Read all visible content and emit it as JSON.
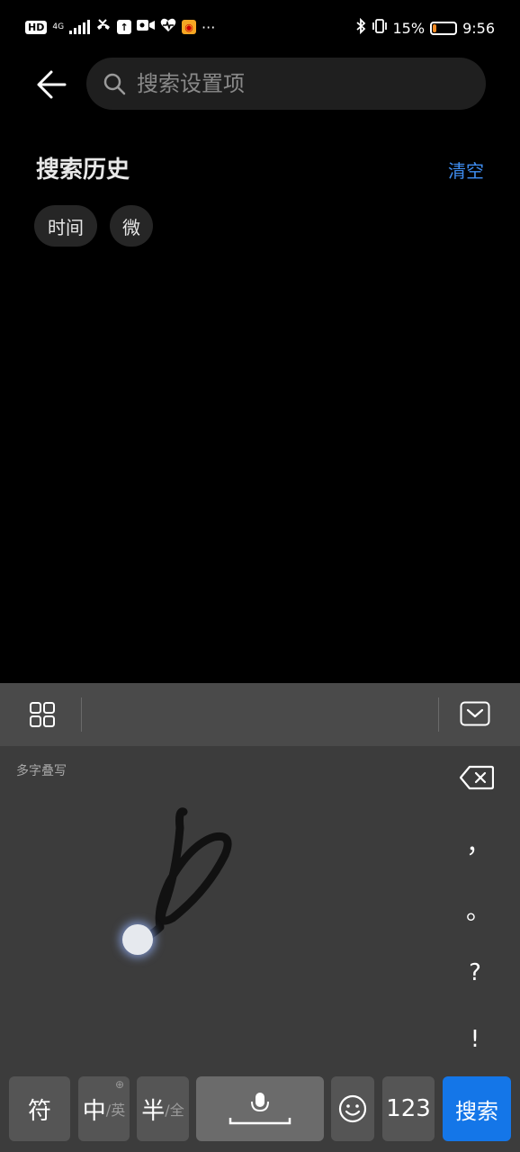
{
  "status_bar": {
    "left_hd": "HD",
    "left_network": "4G",
    "more": "···",
    "battery_percent": "15%",
    "battery_level": 0.15,
    "time": "9:56"
  },
  "header": {
    "search_placeholder": "搜索设置项"
  },
  "history": {
    "title": "搜索历史",
    "clear_label": "清空",
    "items": [
      "时间",
      "微"
    ]
  },
  "keyboard": {
    "mode_label": "多字叠写",
    "punctuation": [
      "，",
      "。",
      "?",
      "!"
    ],
    "keys": {
      "symbols": "符",
      "lang_main": "中",
      "lang_sub": "/英",
      "width_main": "半",
      "width_sub": "/全",
      "numbers": "123",
      "action": "搜索"
    }
  },
  "colors": {
    "accent": "#3f8ef2",
    "action_key": "#1476e8",
    "battery_fill": "#f08a24"
  }
}
